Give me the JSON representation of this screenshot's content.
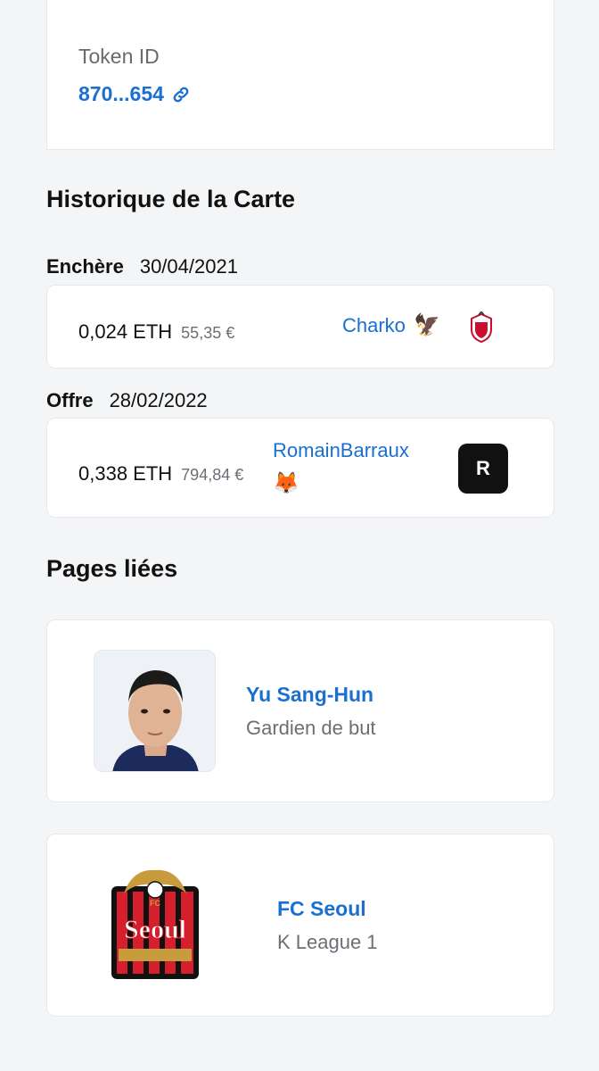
{
  "token": {
    "label": "Token ID",
    "value": "870...654",
    "icon": "link-icon"
  },
  "history": {
    "title": "Historique de la Carte",
    "entries": [
      {
        "kind": "Enchère",
        "date": "30/04/2021",
        "price": "0,024 ETH",
        "fiat": "55,35 €",
        "user": "Charko",
        "user_emoji": "🦅",
        "badge_icon": "club-crest-icon"
      },
      {
        "kind": "Offre",
        "date": "28/02/2022",
        "price": "0,338 ETH",
        "fiat": "794,84 €",
        "user": "RomainBarraux",
        "user_emoji": "🦊",
        "avatar_letter": "R"
      }
    ]
  },
  "linked": {
    "title": "Pages liées",
    "items": [
      {
        "name": "Yu Sang-Hun",
        "sub": "Gardien de but",
        "icon": "player-photo"
      },
      {
        "name": "FC Seoul",
        "sub": "K League 1",
        "icon": "fc-seoul-logo",
        "logo_text": "Seoul",
        "logo_small": "FC"
      }
    ]
  },
  "colors": {
    "accent": "#1a6fd1",
    "background": "#f4f5f7",
    "card": "#ffffff",
    "seoul_red": "#d51f2c",
    "seoul_gold": "#c89b3c"
  }
}
